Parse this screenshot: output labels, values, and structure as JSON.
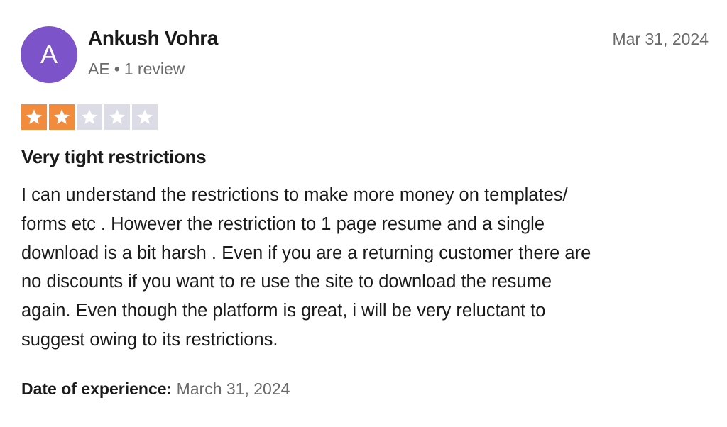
{
  "reviewer": {
    "initial": "A",
    "name": "Ankush Vohra",
    "country": "AE",
    "separator": "•",
    "review_count": "1 review",
    "avatar_color": "#7d53c9"
  },
  "review": {
    "date": "Mar 31, 2024",
    "rating": 2,
    "max_rating": 5,
    "star_filled_color": "#f38b3d",
    "star_empty_color": "#dcdce6",
    "star_icon": "star-icon",
    "title": "Very tight restrictions",
    "body_lines": [
      "I can understand the restrictions to make more money on templates/",
      "forms etc . However the restriction to 1 page resume and a single",
      "download is a bit harsh . Even if you are a returning customer there are",
      "no discounts if you want to re use the site to download the resume",
      "again. Even though the platform is great, i will be very reluctant to",
      "suggest owing to its restrictions."
    ],
    "experience_label": "Date of experience:",
    "experience_date": "March 31, 2024"
  }
}
